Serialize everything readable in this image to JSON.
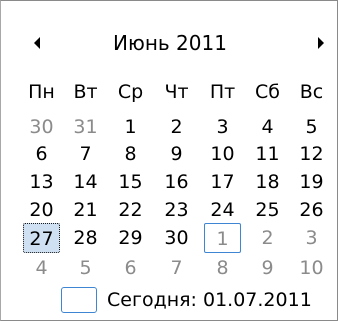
{
  "calendar": {
    "month_title": "Июнь 2011",
    "weekdays": [
      "Пн",
      "Вт",
      "Ср",
      "Чт",
      "Пт",
      "Сб",
      "Вс"
    ],
    "weeks": [
      [
        {
          "d": "30",
          "o": true
        },
        {
          "d": "31",
          "o": true
        },
        {
          "d": "1"
        },
        {
          "d": "2"
        },
        {
          "d": "3"
        },
        {
          "d": "4"
        },
        {
          "d": "5"
        }
      ],
      [
        {
          "d": "6"
        },
        {
          "d": "7"
        },
        {
          "d": "8"
        },
        {
          "d": "9"
        },
        {
          "d": "10"
        },
        {
          "d": "11"
        },
        {
          "d": "12"
        }
      ],
      [
        {
          "d": "13"
        },
        {
          "d": "14"
        },
        {
          "d": "15"
        },
        {
          "d": "16"
        },
        {
          "d": "17"
        },
        {
          "d": "18"
        },
        {
          "d": "19"
        }
      ],
      [
        {
          "d": "20"
        },
        {
          "d": "21"
        },
        {
          "d": "22"
        },
        {
          "d": "23"
        },
        {
          "d": "24"
        },
        {
          "d": "25"
        },
        {
          "d": "26"
        }
      ],
      [
        {
          "d": "27",
          "selected": true
        },
        {
          "d": "28"
        },
        {
          "d": "29"
        },
        {
          "d": "30"
        },
        {
          "d": "1",
          "o": true,
          "today": true
        },
        {
          "d": "2",
          "o": true
        },
        {
          "d": "3",
          "o": true
        }
      ],
      [
        {
          "d": "4",
          "o": true
        },
        {
          "d": "5",
          "o": true
        },
        {
          "d": "6",
          "o": true
        },
        {
          "d": "7",
          "o": true
        },
        {
          "d": "8",
          "o": true
        },
        {
          "d": "9",
          "o": true
        },
        {
          "d": "10",
          "o": true
        }
      ]
    ],
    "today_label": "Сегодня: 01.07.2011",
    "colors": {
      "today_border": "#3e86d4",
      "selected_fill": "#cfe0f3",
      "other_month_text": "#8b8b8b"
    }
  }
}
